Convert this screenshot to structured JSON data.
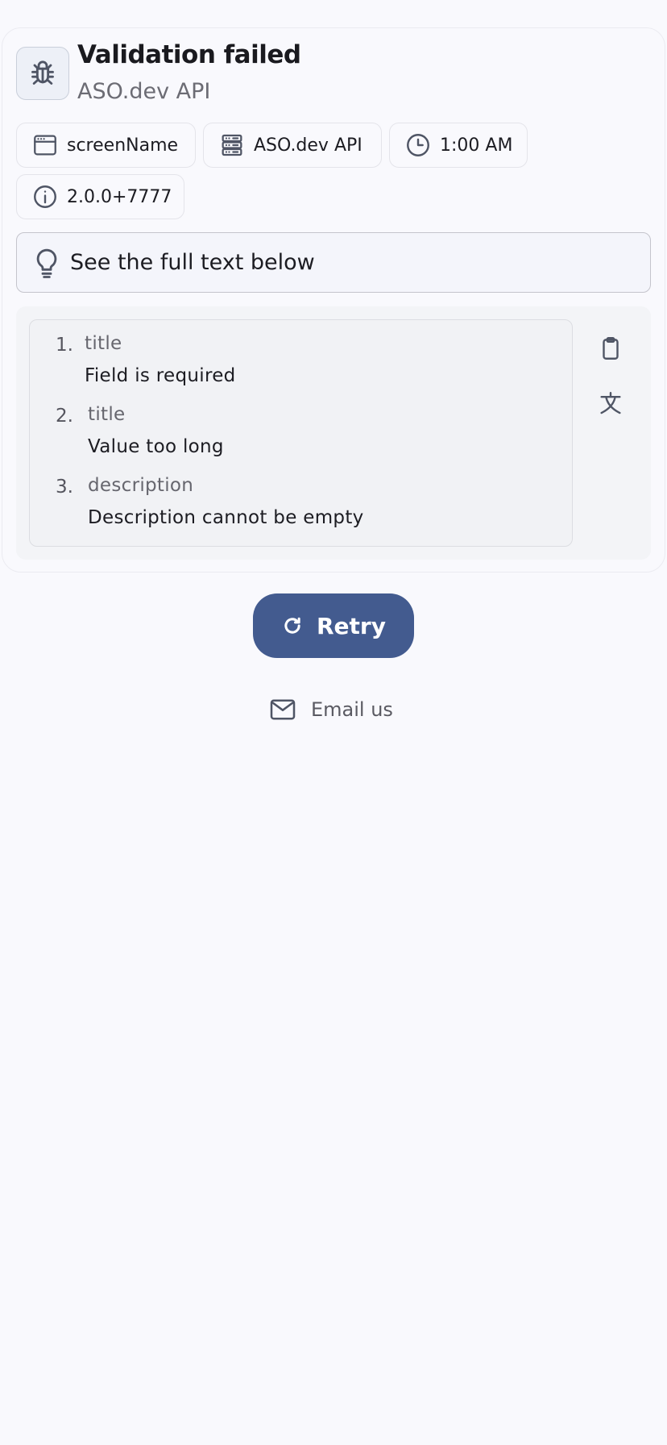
{
  "header": {
    "title": "Validation failed",
    "subtitle": "ASO.dev API",
    "icon": "bug-icon"
  },
  "chips": [
    {
      "icon": "window-icon",
      "label": "screenName"
    },
    {
      "icon": "server-icon",
      "label": "ASO.dev API"
    },
    {
      "icon": "clock-icon",
      "label": "1:00 AM"
    },
    {
      "icon": "info-icon",
      "label": "2.0.0+7777"
    }
  ],
  "hint": {
    "icon": "lightbulb-icon",
    "text": "See the full text below"
  },
  "errors": [
    {
      "number": "1.",
      "field": "title",
      "message": "Field is required"
    },
    {
      "number": "2.",
      "field": "title",
      "message": "Value too long"
    },
    {
      "number": "3.",
      "field": "description",
      "message": "Description cannot be empty"
    }
  ],
  "side_actions": [
    {
      "icon": "clipboard-icon"
    },
    {
      "icon": "translate-icon"
    }
  ],
  "retry": {
    "label": "Retry",
    "icon": "refresh-icon"
  },
  "email": {
    "label": "Email us",
    "icon": "mail-icon"
  },
  "colors": {
    "background": "#f9f9fd",
    "accent": "#435b8f",
    "text": "#1c1c22",
    "muted_text": "#6c6c74"
  }
}
